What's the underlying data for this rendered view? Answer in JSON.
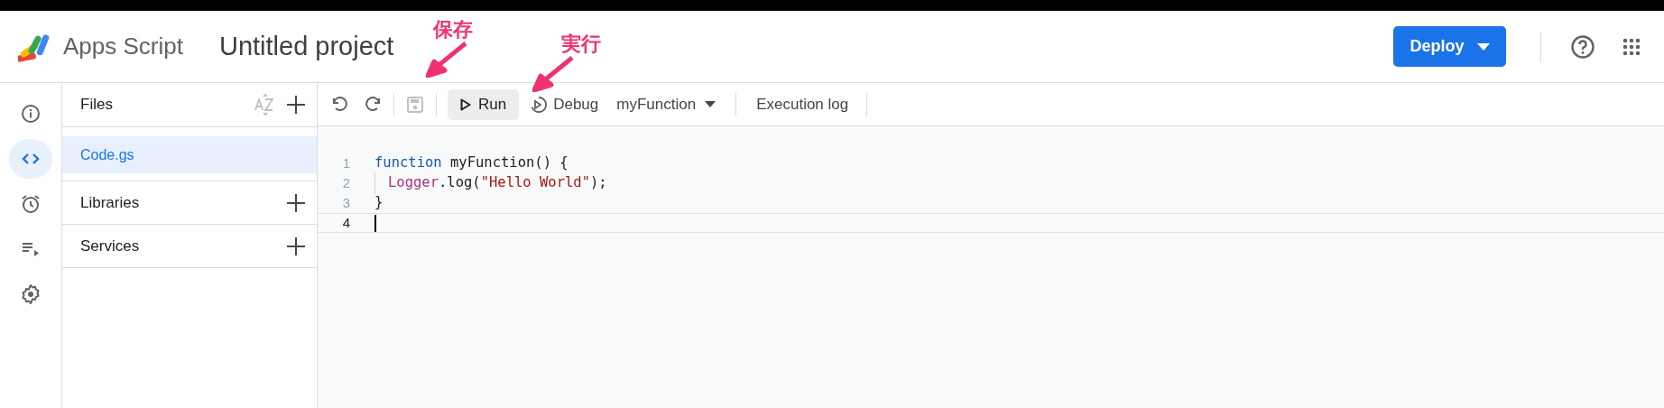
{
  "header": {
    "app_name": "Apps Script",
    "project_title": "Untitled project",
    "deploy_button": "Deploy"
  },
  "rail": [
    {
      "kind": "info",
      "selected": false
    },
    {
      "kind": "code",
      "selected": true
    },
    {
      "kind": "alarm",
      "selected": false
    },
    {
      "kind": "executions",
      "selected": false
    },
    {
      "kind": "settings",
      "selected": false
    }
  ],
  "files_panel": {
    "title": "Files",
    "files": [
      {
        "name": "Code.gs",
        "selected": true
      }
    ],
    "sections": [
      "Libraries",
      "Services"
    ]
  },
  "toolbar": {
    "run": "Run",
    "debug": "Debug",
    "function_select": "myFunction",
    "execution_log": "Execution log"
  },
  "editor": {
    "lines": [
      {
        "number": "1",
        "current": false,
        "indent_guide": false,
        "tokens": [
          {
            "kind": "keyword",
            "text": "function"
          },
          {
            "kind": "plain",
            "text": " myFunction() {"
          }
        ]
      },
      {
        "number": "2",
        "current": false,
        "indent_guide": true,
        "tokens": [
          {
            "kind": "class",
            "text": "Logger"
          },
          {
            "kind": "plain",
            "text": ".log("
          },
          {
            "kind": "string",
            "text": "\"Hello World\""
          },
          {
            "kind": "plain",
            "text": ");"
          }
        ]
      },
      {
        "number": "3",
        "current": false,
        "indent_guide": false,
        "tokens": [
          {
            "kind": "plain",
            "text": "}"
          }
        ]
      },
      {
        "number": "4",
        "current": true
      }
    ]
  },
  "annotations": [
    {
      "kind": "save",
      "text": "保存"
    },
    {
      "kind": "run",
      "text": "実行"
    }
  ]
}
